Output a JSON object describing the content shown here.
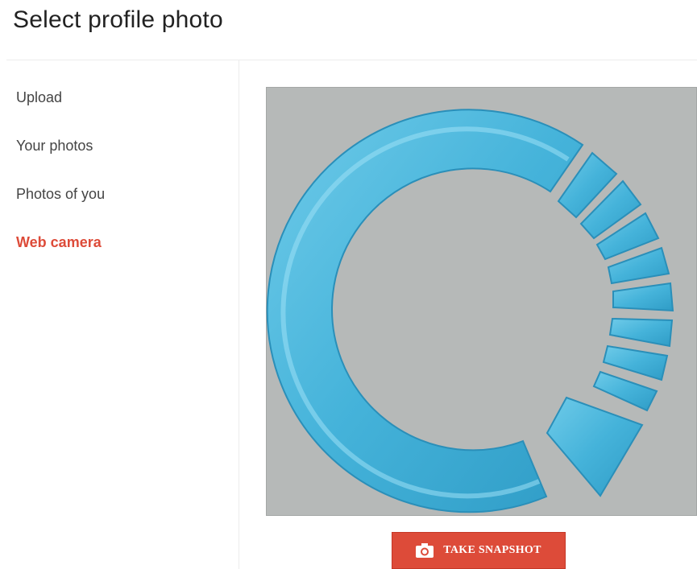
{
  "dialog": {
    "title": "Select profile photo"
  },
  "sidebar": {
    "items": [
      {
        "label": "Upload",
        "active": false
      },
      {
        "label": "Your photos",
        "active": false
      },
      {
        "label": "Photos of you",
        "active": false
      },
      {
        "label": "Web camera",
        "active": true
      }
    ]
  },
  "camera": {
    "preview_icon": "circular-logo-image",
    "snapshot_icon": "camera-icon",
    "snapshot_label": "TAKE SNAPSHOT"
  },
  "colors": {
    "accent": "#dd4b39",
    "preview_background": "#b6b9b8",
    "logo_blue": "#4ab6dc"
  }
}
